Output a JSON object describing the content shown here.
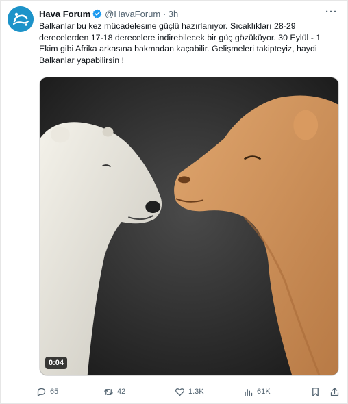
{
  "tweet": {
    "author_name": "Hava Forum",
    "handle_time": "@HavaForum · 3h",
    "text": "Balkanlar bu kez mücadelesine güçlü hazırlanıyor. Sıcaklıkları 28-29 derecelerden 17-18 derecelere indirebilecek bir güç gözüküyor. 30 Eylül - 1 Ekim gibi Afrika arkasına bakmadan kaçabilir. Gelişmeleri takipteyiz, haydi Balkanlar yapabilirsin !",
    "more_label": "···"
  },
  "media": {
    "duration": "0:04"
  },
  "actions": {
    "replies": "65",
    "reposts": "42",
    "likes": "1.3K",
    "views": "61K"
  },
  "icons": {
    "avatar": "hava-forum-logo-icon",
    "verified": "verified-badge-icon",
    "reply": "reply-icon",
    "repost": "repost-icon",
    "like": "heart-icon",
    "views": "views-icon",
    "bookmark": "bookmark-icon",
    "share": "share-icon"
  },
  "colors": {
    "brand_blue": "#1d9bf0",
    "secondary_text": "#536471"
  }
}
